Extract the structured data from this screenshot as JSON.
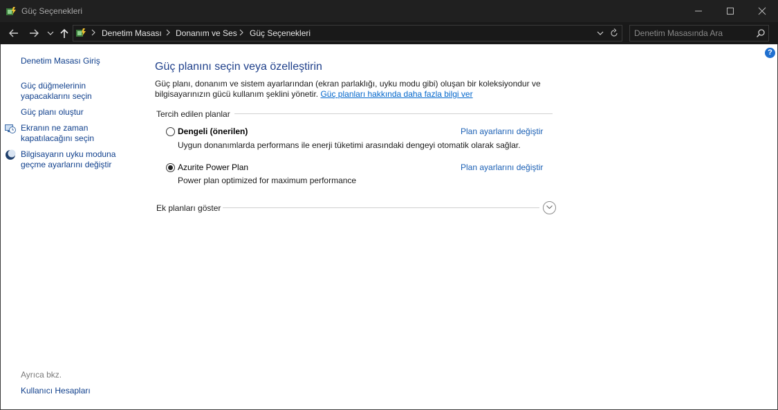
{
  "window": {
    "title": "Güç Seçenekleri",
    "app_icon": "power-options-icon"
  },
  "address_bar": {
    "breadcrumbs": [
      "Denetim Masası",
      "Donanım ve Ses",
      "Güç Seçenekleri"
    ],
    "search_placeholder": "Denetim Masasında Ara"
  },
  "sidebar": {
    "home": "Denetim Masası Giriş",
    "link_buttons_line1": "Güç düğmelerinin",
    "link_buttons_line2": "yapacaklarını seçin",
    "link_create": "Güç planı oluştur",
    "link_display_line1": "Ekranın ne zaman",
    "link_display_line2": "kapatılacağını seçin",
    "link_sleep_line1": "Bilgisayarın uyku moduna",
    "link_sleep_line2": "geçme ayarlarını değiştir",
    "see_also": "Ayrıca bkz.",
    "user_accounts": "Kullanıcı Hesapları"
  },
  "main": {
    "title": "Güç planını seçin veya özelleştirin",
    "description": "Güç planı, donanım ve sistem ayarlarından (ekran parlaklığı, uyku modu gibi) oluşan bir koleksiyondur ve bilgisayarınızın gücü kullanım şeklini yönetir.",
    "description_link": "Güç planları hakkında daha fazla bilgi ver",
    "preferred_group": "Tercih edilen planlar",
    "plans": [
      {
        "name": "Dengeli (önerilen)",
        "description": "Uygun donanımlarda performans ile enerji tüketimi arasındaki dengeyi otomatik olarak sağlar.",
        "change_link": "Plan ayarlarını değiştir",
        "selected": false
      },
      {
        "name": "Azurite Power Plan",
        "description": "Power plan optimized for maximum performance",
        "change_link": "Plan ayarlarını değiştir",
        "selected": true
      }
    ],
    "show_more": "Ek planları göster",
    "help": "?"
  },
  "colors": {
    "titlebar_bg": "#202020",
    "link": "#1a5fb4",
    "heading": "#1e3f8a",
    "help_blue": "#1f6fcf"
  }
}
